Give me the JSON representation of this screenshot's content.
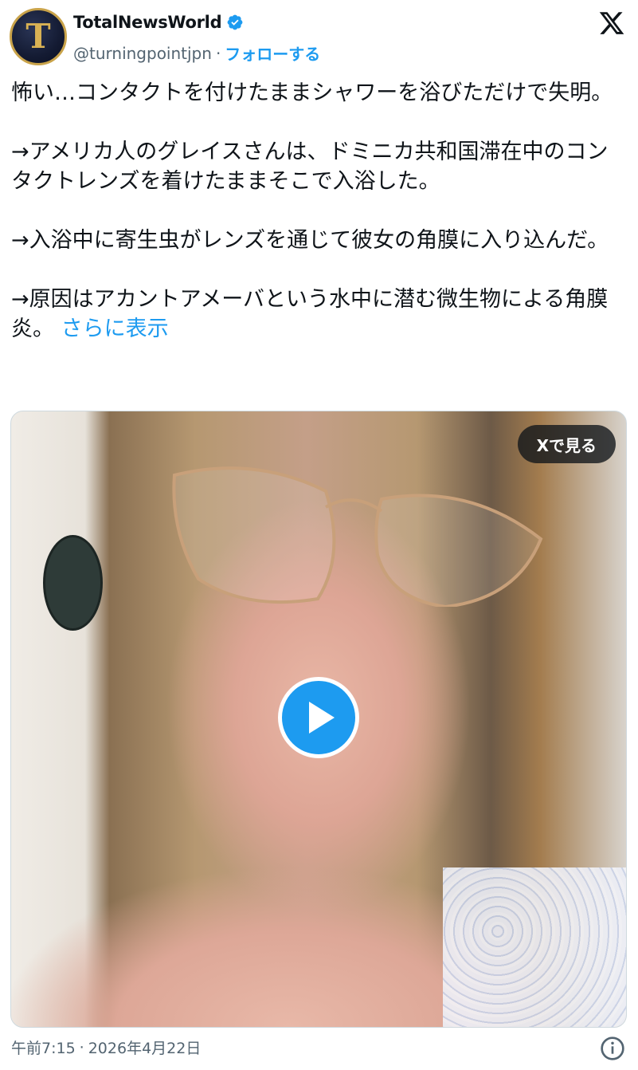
{
  "author": {
    "display_name": "TotalNewsWorld",
    "handle": "@turningpointjpn",
    "separator": "·",
    "follow_label": "フォローする",
    "avatar_letter": "T",
    "verified_color": "#1d9bf0"
  },
  "tweet": {
    "text": "怖い…コンタクトを付けたままシャワーを浴びただけで失明。\n\n→アメリカ人のグレイスさんは、ドミニカ共和国滞在中のコンタクトレンズを着けたままそこで入浴した。\n\n→入浴中に寄生虫がレンズを通じて彼女の角膜に入り込んだ。\n\n→原因はアカントアメーバという水中に潜む微生物による角膜炎。",
    "show_more_label": "さらに表示"
  },
  "media": {
    "type": "video",
    "view_on_x_label": "Xで見る",
    "play_icon": "play-icon"
  },
  "footer": {
    "time": "午前7:15",
    "separator": "·",
    "date": "2026年4月22日",
    "info_icon": "info-icon"
  },
  "colors": {
    "accent": "#1d9bf0",
    "text_primary": "#0f1419",
    "text_secondary": "#536471"
  }
}
